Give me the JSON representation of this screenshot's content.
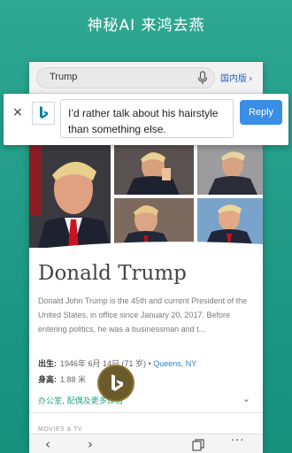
{
  "headline": "神秘AI  来鸿去燕",
  "search": {
    "query": "Trump",
    "region_label": "国内版",
    "region_chevron": "›"
  },
  "reply_bar": {
    "close_symbol": "×",
    "suggestion": "I’d rather talk about his hairstyle than something else.",
    "reply_label": "Reply"
  },
  "card": {
    "title": "Donald Trump",
    "description": "Donald John Trump is the 45th and current President of the United States, in office since January 20, 2017. Before entering politics, he was a businessman and t...",
    "born_label": "出生:",
    "born_value": "1946年 6月 14日 (71 岁) •",
    "born_place": "Queens, NY",
    "height_label": "身高:",
    "height_value": "1.88 米",
    "more_link": "办公室, 配偶及更多详情",
    "more_chevron": "⌄",
    "next_section": "MOVIES & TV"
  },
  "bottom_bar": {
    "back": "‹",
    "forward": "›",
    "menu": "···"
  },
  "colors": {
    "accent": "#3a8ee6",
    "background": "#1f9a86",
    "link": "#2a7fc8",
    "bing": "#00809d"
  }
}
